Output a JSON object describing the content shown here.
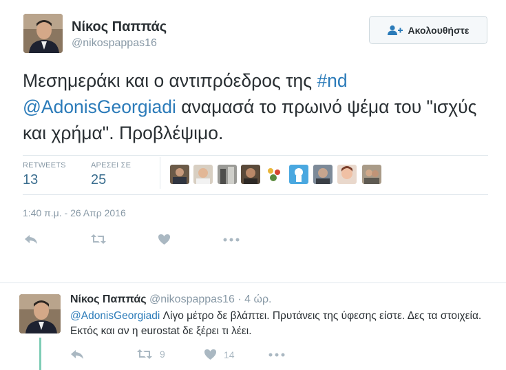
{
  "tweet": {
    "author_name": "Νίκος Παππάς",
    "author_handle": "@nikospappas16",
    "follow_label": "Ακολουθήστε",
    "text_part1": "Μεσημεράκι και ο αντιπρόεδρος της ",
    "hashtag": "#nd",
    "mention": "@AdonisGeorgiadi",
    "text_part2": " αναμασά το πρωινό ψέμα του \"ισχύς και χρήμα\". Προβλέψιμο.",
    "stats": {
      "retweets_label": "RETWEETS",
      "retweets_value": "13",
      "likes_label": "ΑΡΕΣΕΙ ΣΕ",
      "likes_value": "25"
    },
    "timestamp": "1:40 π.μ. - 26 Απρ 2016",
    "liker_avatars": [
      "liker-1",
      "liker-2",
      "liker-3",
      "liker-4",
      "liker-5",
      "liker-6",
      "liker-7",
      "liker-8",
      "liker-9"
    ]
  },
  "reply": {
    "author_name": "Νίκος Παππάς",
    "author_handle": "@nikospappas16",
    "time": "· 4 ώρ.",
    "mention": "@AdonisGeorgiadi",
    "text": " Λίγο μέτρο δε βλάπτει. Πρυτάνεις της ύφεσης είστε. Δες τα στοιχεία. Εκτός και αν η eurostat δε ξέρει τι λέει.",
    "retweet_count": "9",
    "like_count": "14"
  },
  "icons": [
    "user-plus-icon",
    "reply-icon",
    "retweet-icon",
    "heart-icon",
    "more-icon"
  ],
  "colors": {
    "link": "#2b7bb9",
    "stat_value": "#3b6e8f",
    "muted": "#8899a6",
    "icon": "#aab8c2",
    "thread": "#7fcdb6"
  }
}
